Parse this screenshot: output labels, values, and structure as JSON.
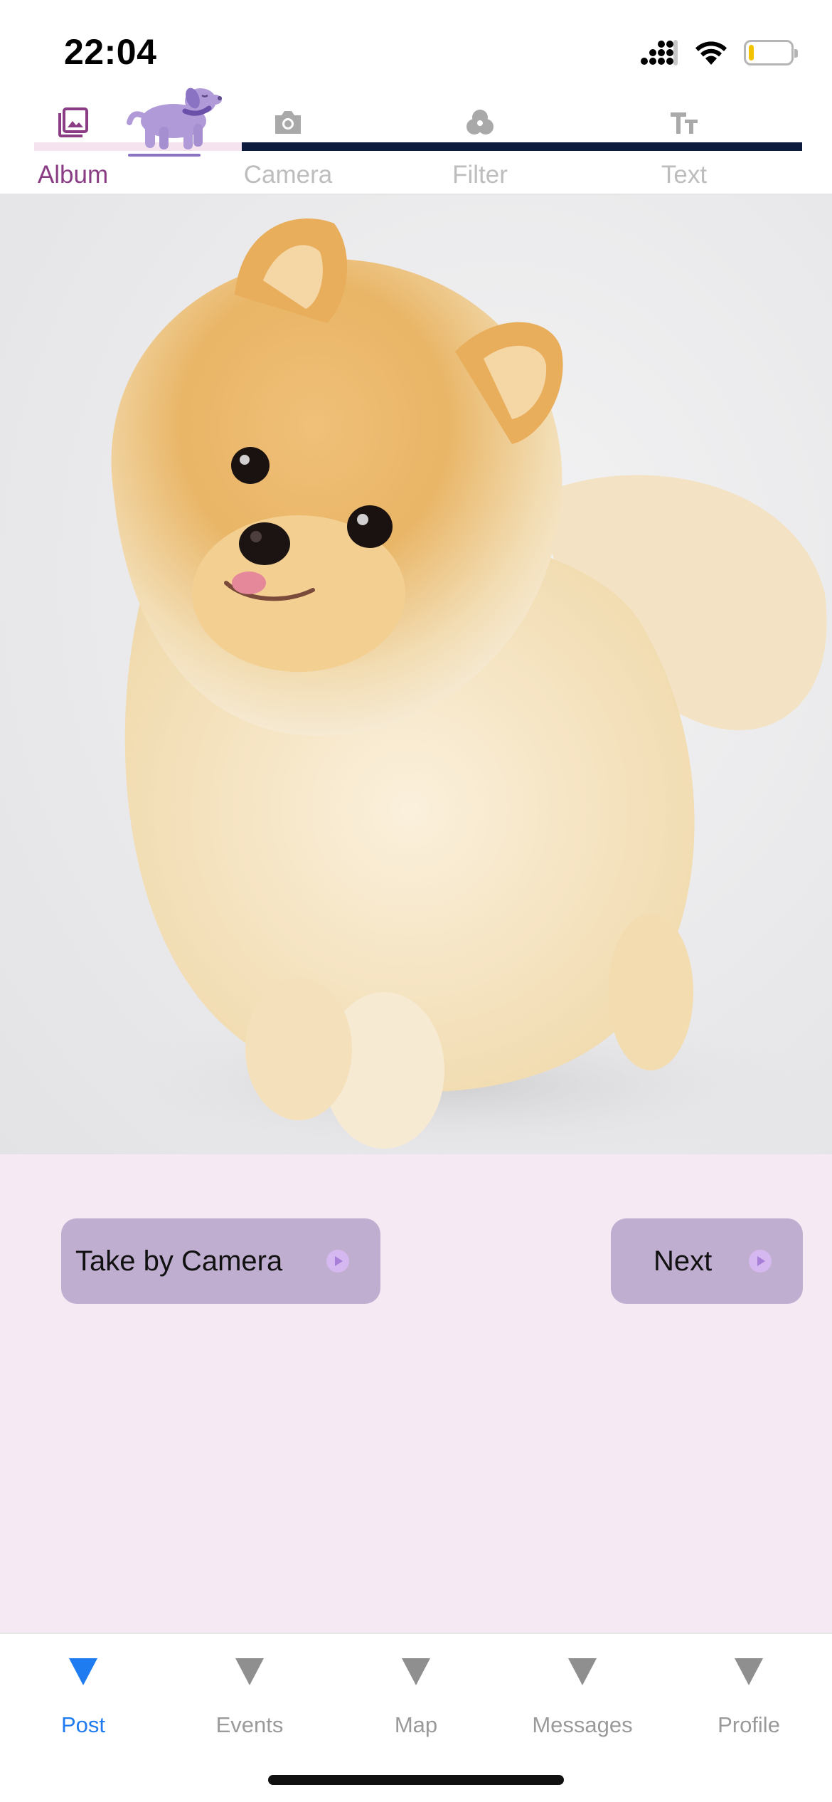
{
  "status_bar": {
    "time": "22:04",
    "signal_icon": "cellular-signal-icon",
    "wifi_icon": "wifi-icon",
    "battery_icon": "battery-icon",
    "battery_level": 0.12,
    "battery_color": "#f3c300"
  },
  "tabs": [
    {
      "label": "Album",
      "icon": "photo-album-icon",
      "active": true
    },
    {
      "label": "Camera",
      "icon": "camera-icon",
      "active": false
    },
    {
      "label": "Filter",
      "icon": "filter-icon",
      "active": false
    },
    {
      "label": "Text",
      "icon": "text-icon",
      "active": false
    }
  ],
  "colors": {
    "active_tab": "#8a3d84",
    "inactive_tab": "#bdbdbd",
    "progress": "#0d1b3e",
    "panel_bg": "#f5e9f4",
    "button_bg": "#c0aed0",
    "nav_active": "#1f7cf0",
    "nav_inactive": "#9a9a9a"
  },
  "photo": {
    "subject": "pomeranian-dog-photo"
  },
  "actions": {
    "take_camera_label": "Take by Camera",
    "next_label": "Next"
  },
  "bottom_nav": [
    {
      "label": "Post",
      "active": true
    },
    {
      "label": "Events",
      "active": false
    },
    {
      "label": "Map",
      "active": false
    },
    {
      "label": "Messages",
      "active": false
    },
    {
      "label": "Profile",
      "active": false
    }
  ]
}
